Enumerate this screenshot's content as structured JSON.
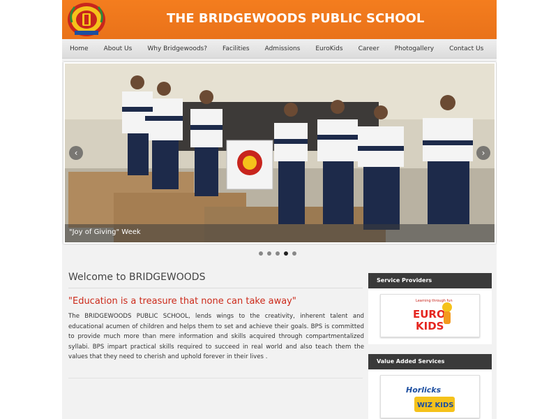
{
  "header": {
    "title": "THE BRIDGEWOODS PUBLIC SCHOOL",
    "logo_icon": "school-crest-icon"
  },
  "nav": {
    "items": [
      "Home",
      "About Us",
      "Why Bridgewoods?",
      "Facilities",
      "Admissions",
      "EuroKids",
      "Career",
      "Photogallery",
      "Contact Us"
    ]
  },
  "slider": {
    "caption": "\"Joy of Giving\" Week",
    "prev_icon": "chevron-left-icon",
    "next_icon": "chevron-right-icon",
    "prev_glyph": "‹",
    "next_glyph": "›",
    "dot_count": 5,
    "active_dot": 4
  },
  "main": {
    "heading": "Welcome to BRIDGEWOODS",
    "quote": "\"Education is a treasure that none can take away\"",
    "body": "The BRIDGEWOODS PUBLIC SCHOOL, lends wings to the creativity, inherent talent and educational acumen of children and helps them to set and achieve their goals. BPS is committed to provide much more than mere information and skills acquired through compartmentalized syllabi. BPS impart practical skills required to succeed in real world and also teach them the values that they need to cherish and uphold forever in their lives ."
  },
  "sidebar": {
    "service_providers": {
      "title": "Service Providers",
      "logo_icon": "eurokids-logo-icon",
      "logo_text_top": "EURO",
      "logo_text_bottom": "KIDS",
      "logo_tagline": "Learning through fun"
    },
    "value_added": {
      "title": "Value Added Services",
      "logo_icon": "horlicks-wizkids-logo-icon",
      "logo_text_top": "Horlicks",
      "logo_text_bottom": "WIZ KIDS"
    }
  },
  "colors": {
    "header_orange": "#f07c1e",
    "quote_red": "#cc2a1a",
    "sidebar_header": "#3a3a3a"
  }
}
